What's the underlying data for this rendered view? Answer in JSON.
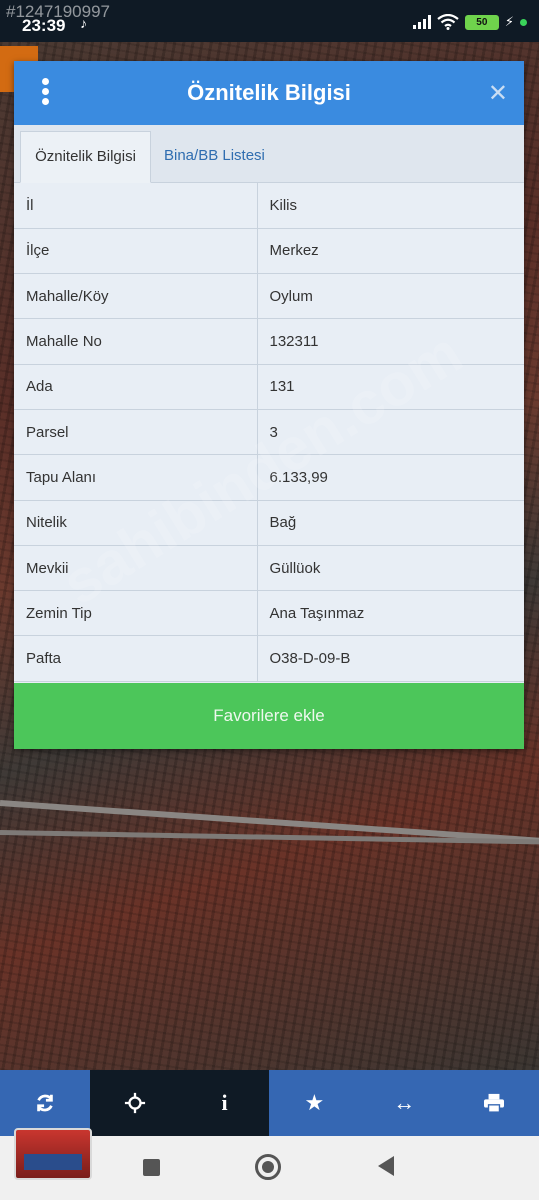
{
  "watermark_id": "#1247190997",
  "status_bar": {
    "time": "23:39",
    "battery": "50"
  },
  "dialog": {
    "title": "Öznitelik Bilgisi",
    "close_icon": "close-icon",
    "tabs": [
      {
        "label": "Öznitelik Bilgisi",
        "active": true
      },
      {
        "label": "Bina/BB Listesi",
        "active": false
      }
    ],
    "rows": [
      {
        "key": "İl",
        "value": "Kilis"
      },
      {
        "key": "İlçe",
        "value": "Merkez"
      },
      {
        "key": "Mahalle/Köy",
        "value": "Oylum"
      },
      {
        "key": "Mahalle No",
        "value": "132311"
      },
      {
        "key": "Ada",
        "value": "131"
      },
      {
        "key": "Parsel",
        "value": "3"
      },
      {
        "key": "Tapu Alanı",
        "value": "6.133,99"
      },
      {
        "key": "Nitelik",
        "value": "Bağ"
      },
      {
        "key": "Mevkii",
        "value": "Güllüok"
      },
      {
        "key": "Zemin Tip",
        "value": "Ana Taşınmaz"
      },
      {
        "key": "Pafta",
        "value": "O38-D-09-B"
      }
    ],
    "favorite_button": "Favorilere ekle"
  },
  "site_watermark": "sahibinden.com",
  "toolbar": {
    "icons": [
      "refresh-icon",
      "crosshair-icon",
      "info-icon",
      "star-icon",
      "measure-icon",
      "print-icon"
    ]
  },
  "colors": {
    "header_blue": "#3a8be0",
    "button_green": "#4cc65a",
    "toolbar_blue": "#3567b3"
  }
}
